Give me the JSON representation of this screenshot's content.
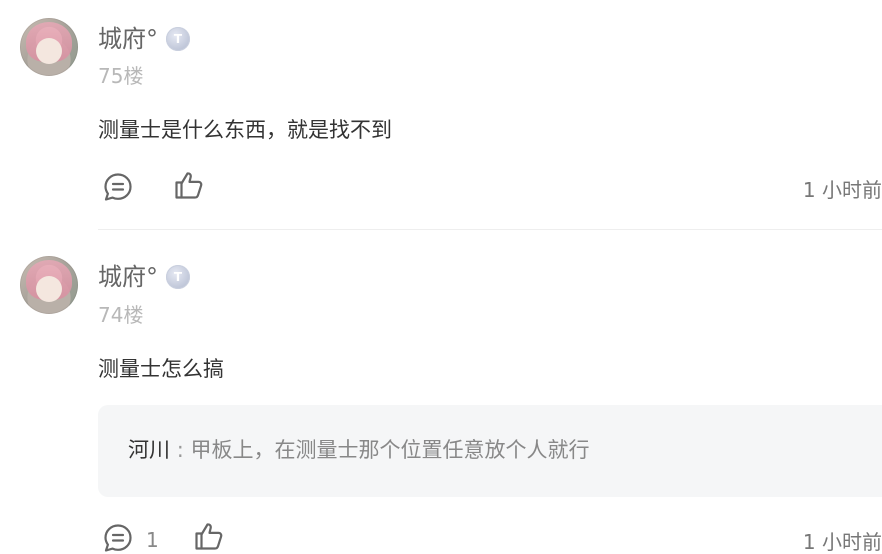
{
  "comments": [
    {
      "username": "城府°",
      "badge_icon": "user-level-badge-icon",
      "badge_text": "T",
      "floor": "75楼",
      "content": "测量士是什么东西，就是找不到",
      "actions": {
        "comment_icon": "comment-icon",
        "like_icon": "thumbs-up-icon"
      },
      "time": "1 小时前"
    },
    {
      "username": "城府°",
      "badge_icon": "user-level-badge-icon",
      "badge_text": "T",
      "floor": "74楼",
      "content": "测量士怎么搞",
      "reply": {
        "author": "河川",
        "separator": ":",
        "text": "甲板上，在测量士那个位置任意放个人就行"
      },
      "actions": {
        "comment_icon": "comment-icon",
        "comment_count": "1",
        "like_icon": "thumbs-up-icon"
      },
      "time": "1 小时前"
    }
  ]
}
